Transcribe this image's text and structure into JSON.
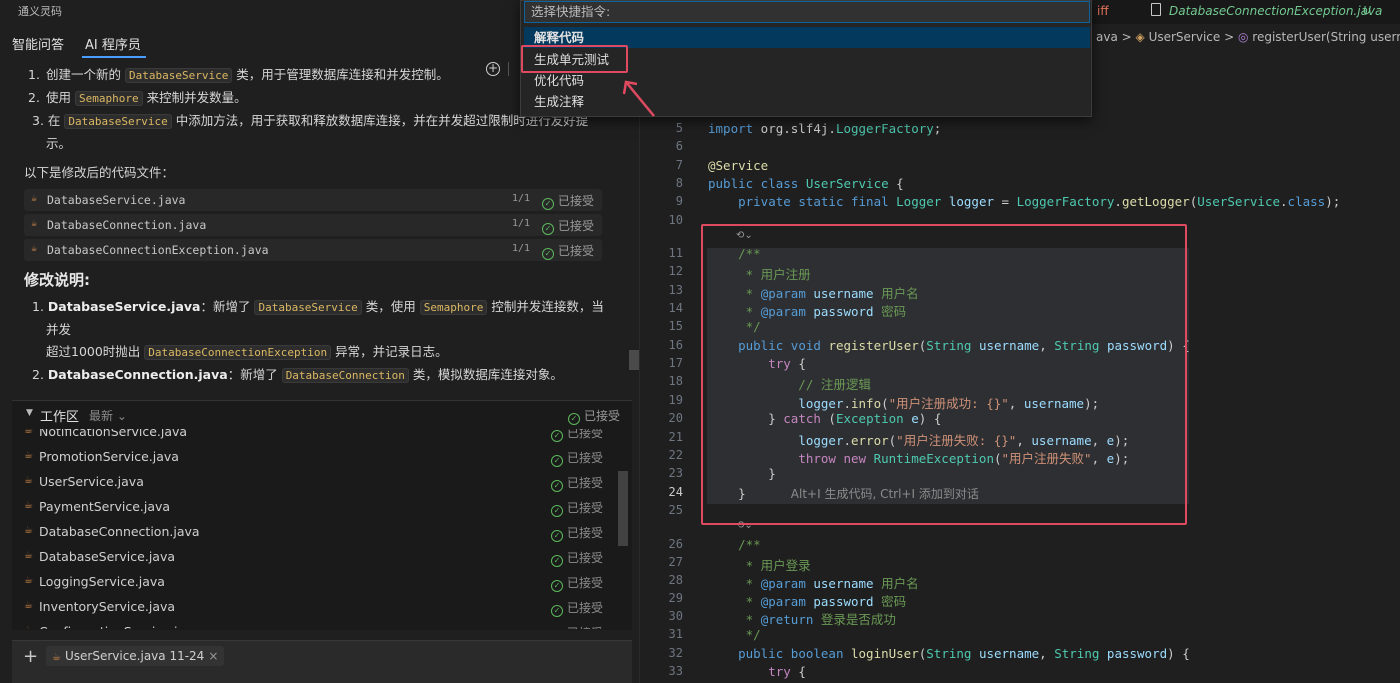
{
  "app": {
    "title": "通义灵码"
  },
  "left_tabs": [
    "智能问答",
    "AI 程序员"
  ],
  "chat": {
    "steps": [
      {
        "num": "1.",
        "pre": "创建一个新的 ",
        "code": "DatabaseService",
        "post": " 类，用于管理数据库连接和并发控制。"
      },
      {
        "num": "2.",
        "pre": "使用 ",
        "code": "Semaphore",
        "post": " 来控制并发数量。"
      },
      {
        "num": "3.",
        "pre": "在 ",
        "code": "DatabaseService",
        "post": " 中添加方法，用于获取和释放数据库连接，并在并发超过限制时进行友好提示。"
      }
    ],
    "intro": "以下是修改后的代码文件：",
    "files": [
      {
        "name": "DatabaseService.java",
        "count": "1/1",
        "status": "已接受"
      },
      {
        "name": "DatabaseConnection.java",
        "count": "1/1",
        "status": "已接受"
      },
      {
        "name": "DatabaseConnectionException.java",
        "count": "1/1",
        "status": "已接受"
      }
    ],
    "section_title": "修改说明:",
    "notes": [
      {
        "num": "1.",
        "bold": "DatabaseService.java",
        "a": "：新增了 ",
        "code": "DatabaseService",
        "b": " 类，使用 ",
        "code2": "Semaphore",
        "c": " 控制并发连接数，当并发",
        "line2a": "超过1000时抛出 ",
        "code3": "DatabaseConnectionException",
        "line2b": " 异常，并记录日志。"
      },
      {
        "num": "2.",
        "bold": "DatabaseConnection.java",
        "a": "：新增了 ",
        "code": "DatabaseConnection",
        "b": " 类，模拟数据库连接对象。"
      }
    ]
  },
  "workspace": {
    "title": "工作区",
    "filter": "最新",
    "status": "已接受",
    "files": [
      {
        "name": "NotificationService.java",
        "status": "已接受"
      },
      {
        "name": "PromotionService.java",
        "status": "已接受"
      },
      {
        "name": "UserService.java",
        "status": "已接受"
      },
      {
        "name": "PaymentService.java",
        "status": "已接受"
      },
      {
        "name": "DatabaseConnection.java",
        "status": "已接受"
      },
      {
        "name": "DatabaseService.java",
        "status": "已接受"
      },
      {
        "name": "LoggingService.java",
        "status": "已接受"
      },
      {
        "name": "InventoryService.java",
        "status": "已接受"
      },
      {
        "name": "ConfigurationService.java",
        "status": "已接受"
      }
    ]
  },
  "input": {
    "ref_chip": "UserService.java 11-24"
  },
  "palette": {
    "placeholder": "选择快捷指令:",
    "commands": [
      "解释代码",
      "生成单元测试",
      "优化代码",
      "生成注释"
    ]
  },
  "editor": {
    "tab_partial": "iff",
    "tab_file": "DatabaseConnectionException.java",
    "tab_badge": "U",
    "breadcrumb": [
      "ava",
      "UserService",
      "registerUser(String username"
    ],
    "ghost_hint": "Alt+I 生成代码, Ctrl+I 添加到对话",
    "line_numbers": [
      "5",
      "6",
      "7",
      "8",
      "9",
      "10",
      "11",
      "12",
      "13",
      "14",
      "15",
      "16",
      "17",
      "18",
      "19",
      "20",
      "21",
      "22",
      "23",
      "24",
      "25",
      "26",
      "27",
      "28",
      "29",
      "30",
      "31",
      "32",
      "33"
    ]
  }
}
